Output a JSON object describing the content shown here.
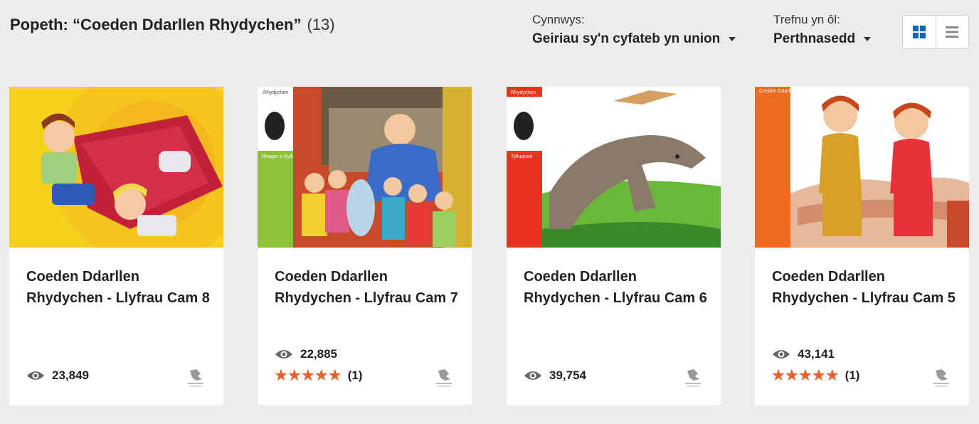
{
  "header": {
    "title": "Popeth: “Coeden Ddarllen Rhydychen”",
    "count": "(13)"
  },
  "filters": {
    "content": {
      "label": "Cynnwys:",
      "value": "Geiriau sy'n cyfateb yn union"
    },
    "sort": {
      "label": "Trefnu yn ôl:",
      "value": "Perthnasedd"
    }
  },
  "view": {
    "selected": "grid"
  },
  "colors": {
    "accent": "#1a73c8",
    "star": "#e8602c",
    "background": "#ececec"
  },
  "cards": [
    {
      "title": "Coeden Ddarllen Rhydychen - Llyfrau Cam 8",
      "views": "23,849",
      "rating": null,
      "rating_count": null
    },
    {
      "title": "Coeden Ddarllen Rhydychen - Llyfrau Cam 7",
      "views": "22,885",
      "rating": "★★★★★",
      "rating_count": "(1)",
      "cover_strip_text": "Rhydychen",
      "cover_label": "Rhagor o Dylluanod"
    },
    {
      "title": "Coeden Ddarllen Rhydychen - Llyfrau Cam 6",
      "views": "39,754",
      "rating": null,
      "rating_count": null,
      "cover_strip_text": "Rhydychen",
      "cover_label": "Tylluanod"
    },
    {
      "title": "Coeden Ddarllen Rhydychen - Llyfrau Cam 5",
      "views": "43,141",
      "rating": "★★★★★",
      "rating_count": "(1)",
      "cover_strip_text": "Coeden Ddarllen Rhydychen"
    }
  ]
}
